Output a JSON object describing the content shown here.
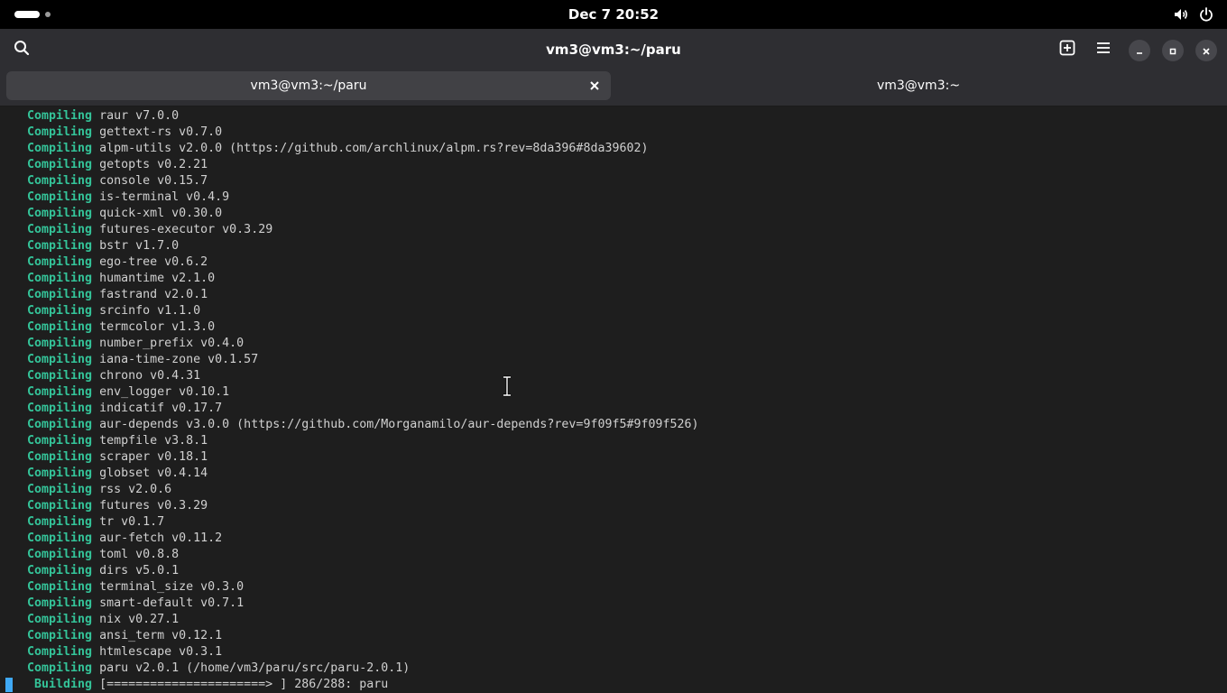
{
  "topbar": {
    "clock": "Dec 7  20:52",
    "icons": [
      "volume-icon",
      "power-icon"
    ]
  },
  "header": {
    "title": "vm3@vm3:~/paru",
    "icons": [
      "search-icon",
      "new-tab-icon",
      "menu-icon",
      "minimize-icon",
      "maximize-icon",
      "close-icon"
    ]
  },
  "tabs": [
    {
      "label": "vm3@vm3:~/paru",
      "active": true
    },
    {
      "label": "vm3@vm3:~",
      "active": false
    }
  ],
  "terminal": {
    "verb_color": "#34c499",
    "lines": [
      {
        "verb": "Compiling",
        "text": "raur v7.0.0"
      },
      {
        "verb": "Compiling",
        "text": "gettext-rs v0.7.0"
      },
      {
        "verb": "Compiling",
        "text": "alpm-utils v2.0.0 (https://github.com/archlinux/alpm.rs?rev=8da396#8da39602)"
      },
      {
        "verb": "Compiling",
        "text": "getopts v0.2.21"
      },
      {
        "verb": "Compiling",
        "text": "console v0.15.7"
      },
      {
        "verb": "Compiling",
        "text": "is-terminal v0.4.9"
      },
      {
        "verb": "Compiling",
        "text": "quick-xml v0.30.0"
      },
      {
        "verb": "Compiling",
        "text": "futures-executor v0.3.29"
      },
      {
        "verb": "Compiling",
        "text": "bstr v1.7.0"
      },
      {
        "verb": "Compiling",
        "text": "ego-tree v0.6.2"
      },
      {
        "verb": "Compiling",
        "text": "humantime v2.1.0"
      },
      {
        "verb": "Compiling",
        "text": "fastrand v2.0.1"
      },
      {
        "verb": "Compiling",
        "text": "srcinfo v1.1.0"
      },
      {
        "verb": "Compiling",
        "text": "termcolor v1.3.0"
      },
      {
        "verb": "Compiling",
        "text": "number_prefix v0.4.0"
      },
      {
        "verb": "Compiling",
        "text": "iana-time-zone v0.1.57"
      },
      {
        "verb": "Compiling",
        "text": "chrono v0.4.31"
      },
      {
        "verb": "Compiling",
        "text": "env_logger v0.10.1"
      },
      {
        "verb": "Compiling",
        "text": "indicatif v0.17.7"
      },
      {
        "verb": "Compiling",
        "text": "aur-depends v3.0.0 (https://github.com/Morganamilo/aur-depends?rev=9f09f5#9f09f526)"
      },
      {
        "verb": "Compiling",
        "text": "tempfile v3.8.1"
      },
      {
        "verb": "Compiling",
        "text": "scraper v0.18.1"
      },
      {
        "verb": "Compiling",
        "text": "globset v0.4.14"
      },
      {
        "verb": "Compiling",
        "text": "rss v2.0.6"
      },
      {
        "verb": "Compiling",
        "text": "futures v0.3.29"
      },
      {
        "verb": "Compiling",
        "text": "tr v0.1.7"
      },
      {
        "verb": "Compiling",
        "text": "aur-fetch v0.11.2"
      },
      {
        "verb": "Compiling",
        "text": "toml v0.8.8"
      },
      {
        "verb": "Compiling",
        "text": "dirs v5.0.1"
      },
      {
        "verb": "Compiling",
        "text": "terminal_size v0.3.0"
      },
      {
        "verb": "Compiling",
        "text": "smart-default v0.7.1"
      },
      {
        "verb": "Compiling",
        "text": "nix v0.27.1"
      },
      {
        "verb": "Compiling",
        "text": "ansi_term v0.12.1"
      },
      {
        "verb": "Compiling",
        "text": "htmlescape v0.3.1"
      },
      {
        "verb": "Compiling",
        "text": "paru v2.0.1 (/home/vm3/paru/src/paru-2.0.1)"
      }
    ],
    "build": {
      "verb": "Building",
      "text": "[======================> ] 286/288: paru"
    }
  }
}
